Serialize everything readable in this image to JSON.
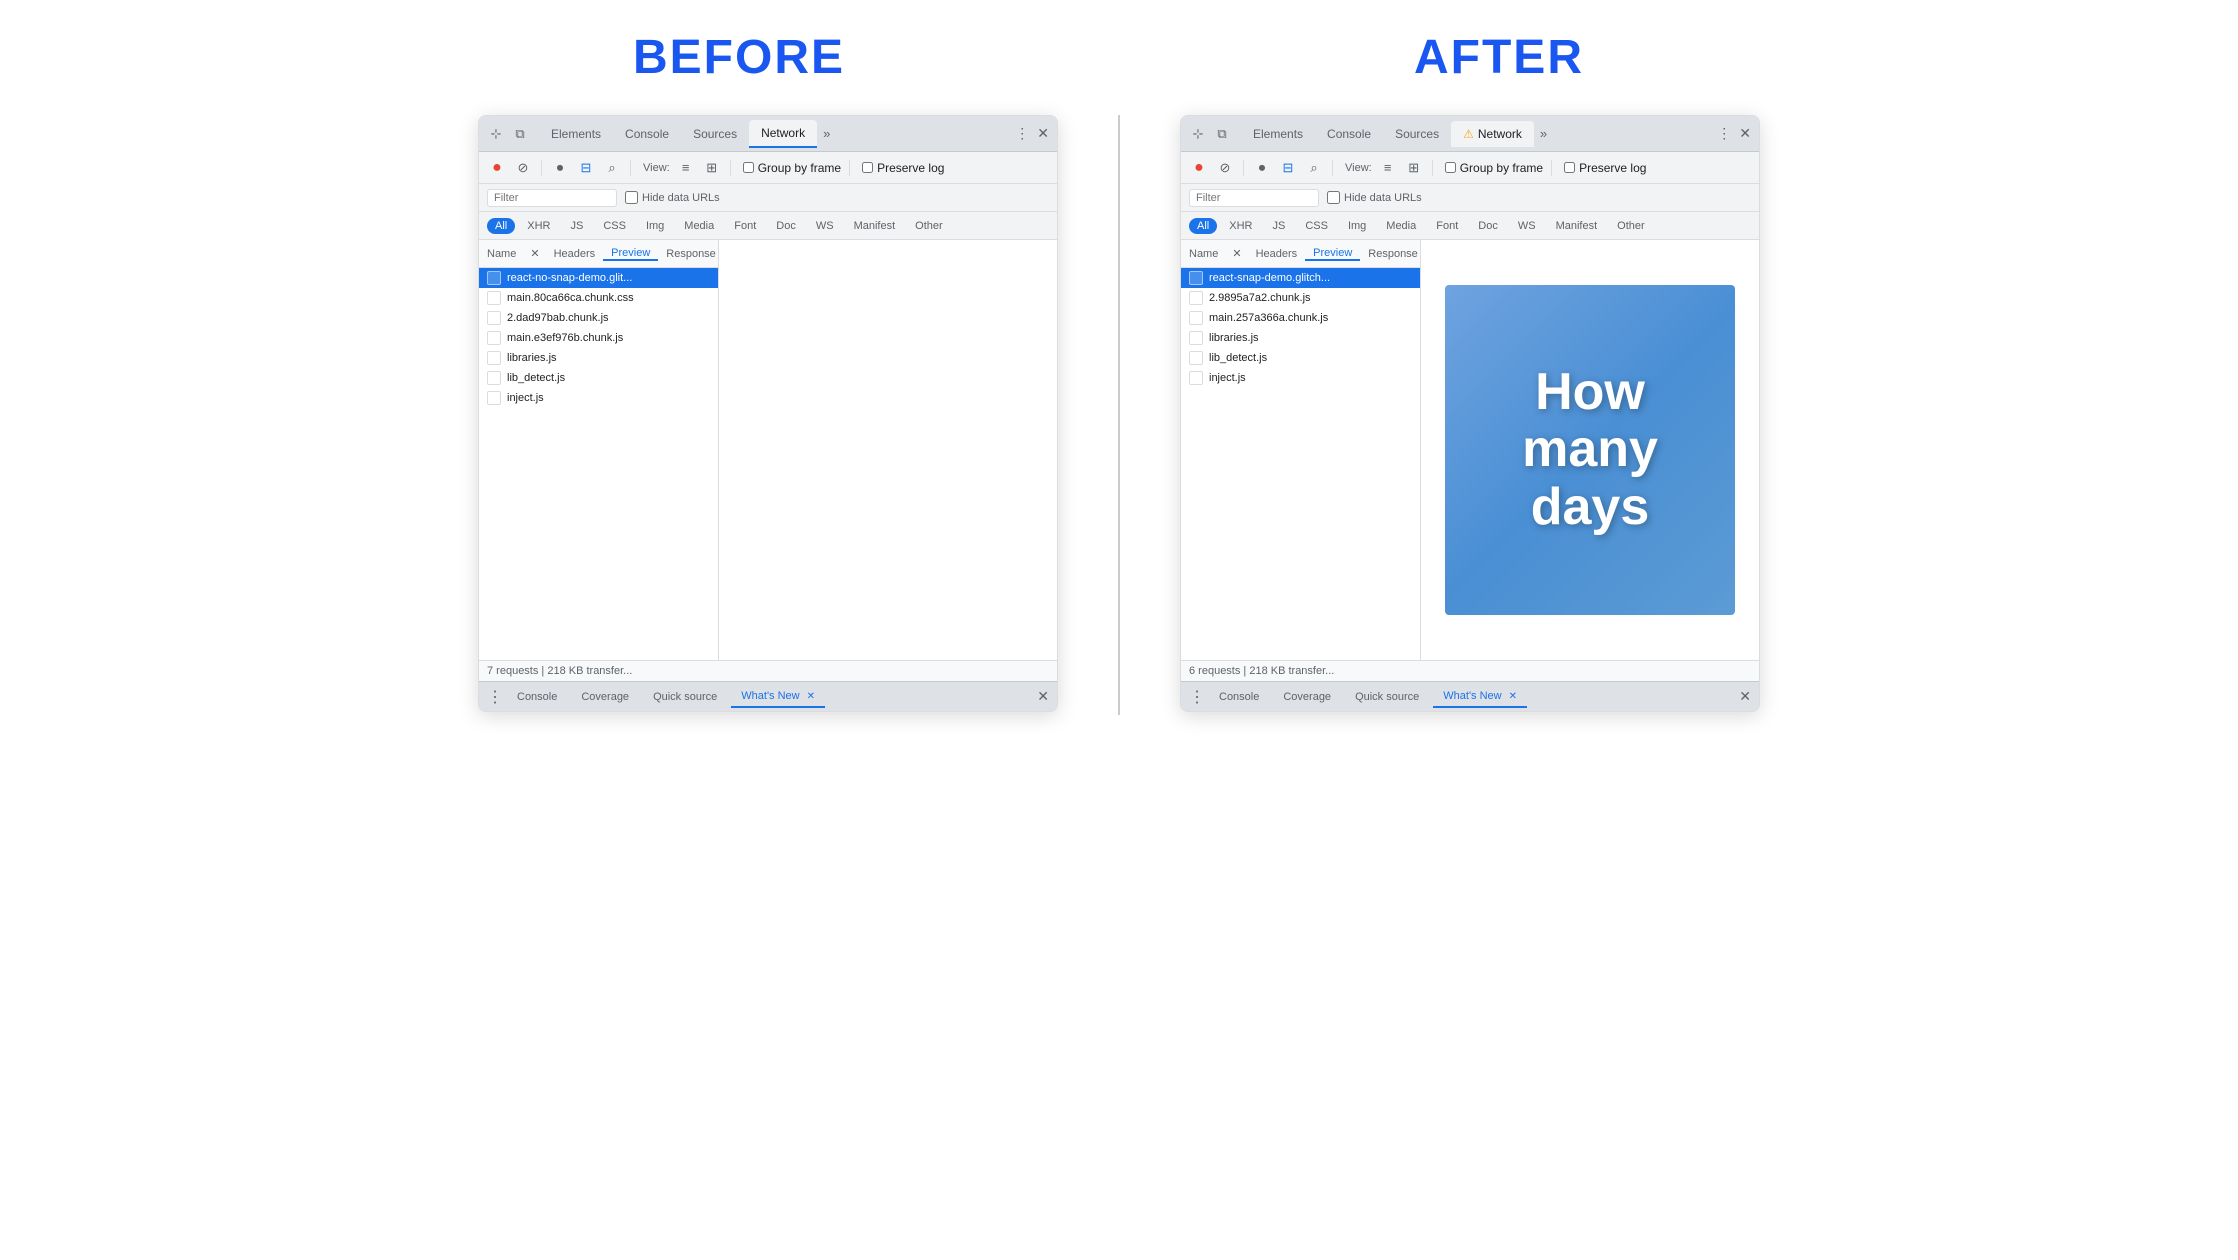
{
  "labels": {
    "before": "BEFORE",
    "after": "AFTER"
  },
  "before_panel": {
    "tabs": [
      "Elements",
      "Console",
      "Sources",
      "Network"
    ],
    "active_tab": "Network",
    "more_tabs": "»",
    "toolbar": {
      "view_label": "View:",
      "group_by_frame_label": "Group by frame",
      "preserve_log_label": "Preserve log"
    },
    "filter_placeholder": "Filter",
    "hide_data_urls": "Hide data URLs",
    "resource_types": [
      "All",
      "XHR",
      "JS",
      "CSS",
      "Img",
      "Media",
      "Font",
      "Doc",
      "WS",
      "Manifest",
      "Other"
    ],
    "active_resource": "All",
    "file_list_header": "Name",
    "sub_tabs": [
      "Headers",
      "Preview",
      "Response"
    ],
    "active_sub_tab": "Preview",
    "files": [
      "react-no-snap-demo.glit...",
      "main.80ca66ca.chunk.css",
      "2.dad97bab.chunk.js",
      "main.e3ef976b.chunk.js",
      "libraries.js",
      "lib_detect.js",
      "inject.js"
    ],
    "selected_file": 0,
    "status_bar": "7 requests | 218 KB transfer...",
    "bottom_tabs": [
      "Console",
      "Coverage",
      "Quick source",
      "What's New"
    ],
    "active_bottom_tab": "What's New"
  },
  "after_panel": {
    "tabs": [
      "Elements",
      "Console",
      "Sources",
      "Network"
    ],
    "active_tab": "Network",
    "active_tab_has_warning": true,
    "more_tabs": "»",
    "toolbar": {
      "view_label": "View:",
      "group_by_frame_label": "Group by frame",
      "preserve_log_label": "Preserve log"
    },
    "filter_placeholder": "Filter",
    "hide_data_urls": "Hide data URLs",
    "resource_types": [
      "All",
      "XHR",
      "JS",
      "CSS",
      "Img",
      "Media",
      "Font",
      "Doc",
      "WS",
      "Manifest",
      "Other"
    ],
    "active_resource": "All",
    "file_list_header": "Name",
    "sub_tabs": [
      "Headers",
      "Preview",
      "Response"
    ],
    "active_sub_tab": "Preview",
    "files": [
      "react-snap-demo.glitch...",
      "2.9895a7a2.chunk.js",
      "main.257a366a.chunk.js",
      "libraries.js",
      "lib_detect.js",
      "inject.js"
    ],
    "selected_file": 0,
    "preview_text": "How\nmany\ndays",
    "status_bar": "6 requests | 218 KB transfer...",
    "bottom_tabs": [
      "Console",
      "Coverage",
      "Quick source",
      "What's New"
    ],
    "active_bottom_tab": "What's New"
  },
  "icons": {
    "cursor": "⊹",
    "device": "⧉",
    "record_red": "●",
    "stop": "⊘",
    "camera": "⏺",
    "filter": "⊟",
    "search": "⌕",
    "list1": "≡",
    "list2": "⊞",
    "more_vert": "⋮",
    "close": "✕",
    "warning": "⚠"
  }
}
